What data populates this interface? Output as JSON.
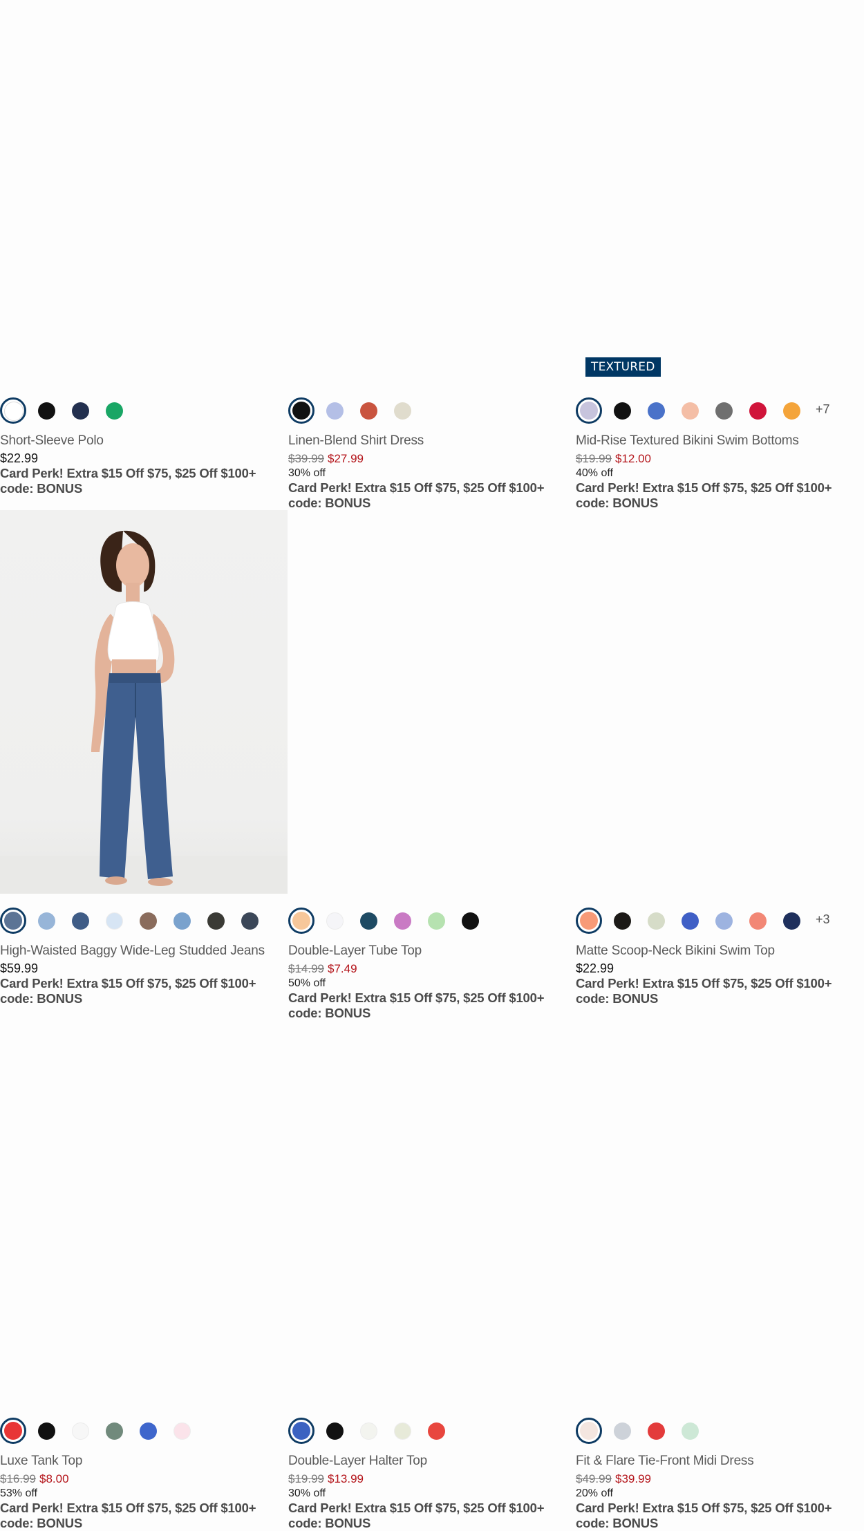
{
  "products": [
    {
      "name": "Short-Sleeve Polo",
      "price": "$22.99",
      "was": "",
      "now": "",
      "off": "",
      "perk_line1": "Card Perk! Extra $15 Off $75, $25 Off $100+",
      "perk_line2": "code: BONUS",
      "tag": "",
      "swatches": [
        "#ffffff",
        "#111111",
        "#23304f",
        "#19a665"
      ],
      "more": ""
    },
    {
      "name": "Linen-Blend Shirt Dress",
      "price": "",
      "was": "$39.99",
      "now": "$27.99",
      "off": "30% off",
      "perk_line1": "Card Perk! Extra $15 Off $75, $25 Off $100+",
      "perk_line2": "code: BONUS",
      "tag": "",
      "swatches": [
        "#111111",
        "#b4bfe6",
        "#c9543f",
        "#e0dccd"
      ],
      "more": ""
    },
    {
      "name": "Mid-Rise Textured Bikini Swim Bottoms",
      "price": "",
      "was": "$19.99",
      "now": "$12.00",
      "off": "40% off",
      "perk_line1": "Card Perk! Extra $15 Off $75, $25 Off $100+",
      "perk_line2": "code: BONUS",
      "tag": "TEXTURED",
      "swatches": [
        "#c7c4dd",
        "#111111",
        "#4a72c9",
        "#f4bea6",
        "#6f6f6f",
        "#d0143a",
        "#f4a43a"
      ],
      "more": "+7"
    },
    {
      "name": "High-Waisted Baggy Wide-Leg Studded Jeans",
      "price": "$59.99",
      "was": "",
      "now": "",
      "off": "",
      "perk_line1": "Card Perk! Extra $15 Off $75, $25 Off $100+",
      "perk_line2": "code: BONUS",
      "tag": "",
      "swatches": [
        "#5c7495",
        "#97b5d8",
        "#3f5c86",
        "#d7e5f4",
        "#8a6c5c",
        "#7aa2cd",
        "#3a3a35",
        "#3b4758"
      ],
      "more": ""
    },
    {
      "name": "Double-Layer Tube Top",
      "price": "",
      "was": "$14.99",
      "now": "$7.49",
      "off": "50% off",
      "perk_line1": "Card Perk! Extra $15 Off $75, $25 Off $100+",
      "perk_line2": "code: BONUS",
      "tag": "",
      "swatches": [
        "#f7c79a",
        "#f5f5f8",
        "#1e4a63",
        "#c97ac4",
        "#b6e2b0",
        "#111111"
      ],
      "more": ""
    },
    {
      "name": "Matte Scoop-Neck Bikini Swim Top",
      "price": "$22.99",
      "was": "",
      "now": "",
      "off": "",
      "perk_line1": "Card Perk! Extra $15 Off $75, $25 Off $100+",
      "perk_line2": "code: BONUS",
      "tag": "",
      "swatches": [
        "#f79a78",
        "#1c1a17",
        "#d6dcc8",
        "#3f5fc6",
        "#9db3e0",
        "#f28775",
        "#1e2f5c"
      ],
      "more": "+3"
    },
    {
      "name": "Luxe Tank Top",
      "price": "",
      "was": "$16.99",
      "now": "$8.00",
      "off": "53% off",
      "perk_line1": "Card Perk! Extra $15 Off $75, $25 Off $100+",
      "perk_line2": "code: BONUS",
      "tag": "",
      "swatches": [
        "#e83636",
        "#111111",
        "#f7f7f7",
        "#718a7c",
        "#3e66cc",
        "#fbe3ea"
      ],
      "more": ""
    },
    {
      "name": "Double-Layer Halter Top",
      "price": "",
      "was": "$19.99",
      "now": "$13.99",
      "off": "30% off",
      "perk_line1": "Card Perk! Extra $15 Off $75, $25 Off $100+",
      "perk_line2": "code: BONUS",
      "tag": "",
      "swatches": [
        "#3b62c1",
        "#111111",
        "#f3f4ef",
        "#e7ead9",
        "#e8463e"
      ],
      "more": ""
    },
    {
      "name": "Fit & Flare Tie-Front Midi Dress",
      "price": "",
      "was": "$49.99",
      "now": "$39.99",
      "off": "20% off",
      "perk_line1": "Card Perk! Extra $15 Off $75, $25 Off $100+",
      "perk_line2": "code: BONUS",
      "tag": "",
      "swatches": [
        "#f4e6e0",
        "#cdd2d9",
        "#e33b3b",
        "#cde8d6"
      ],
      "more": ""
    }
  ]
}
